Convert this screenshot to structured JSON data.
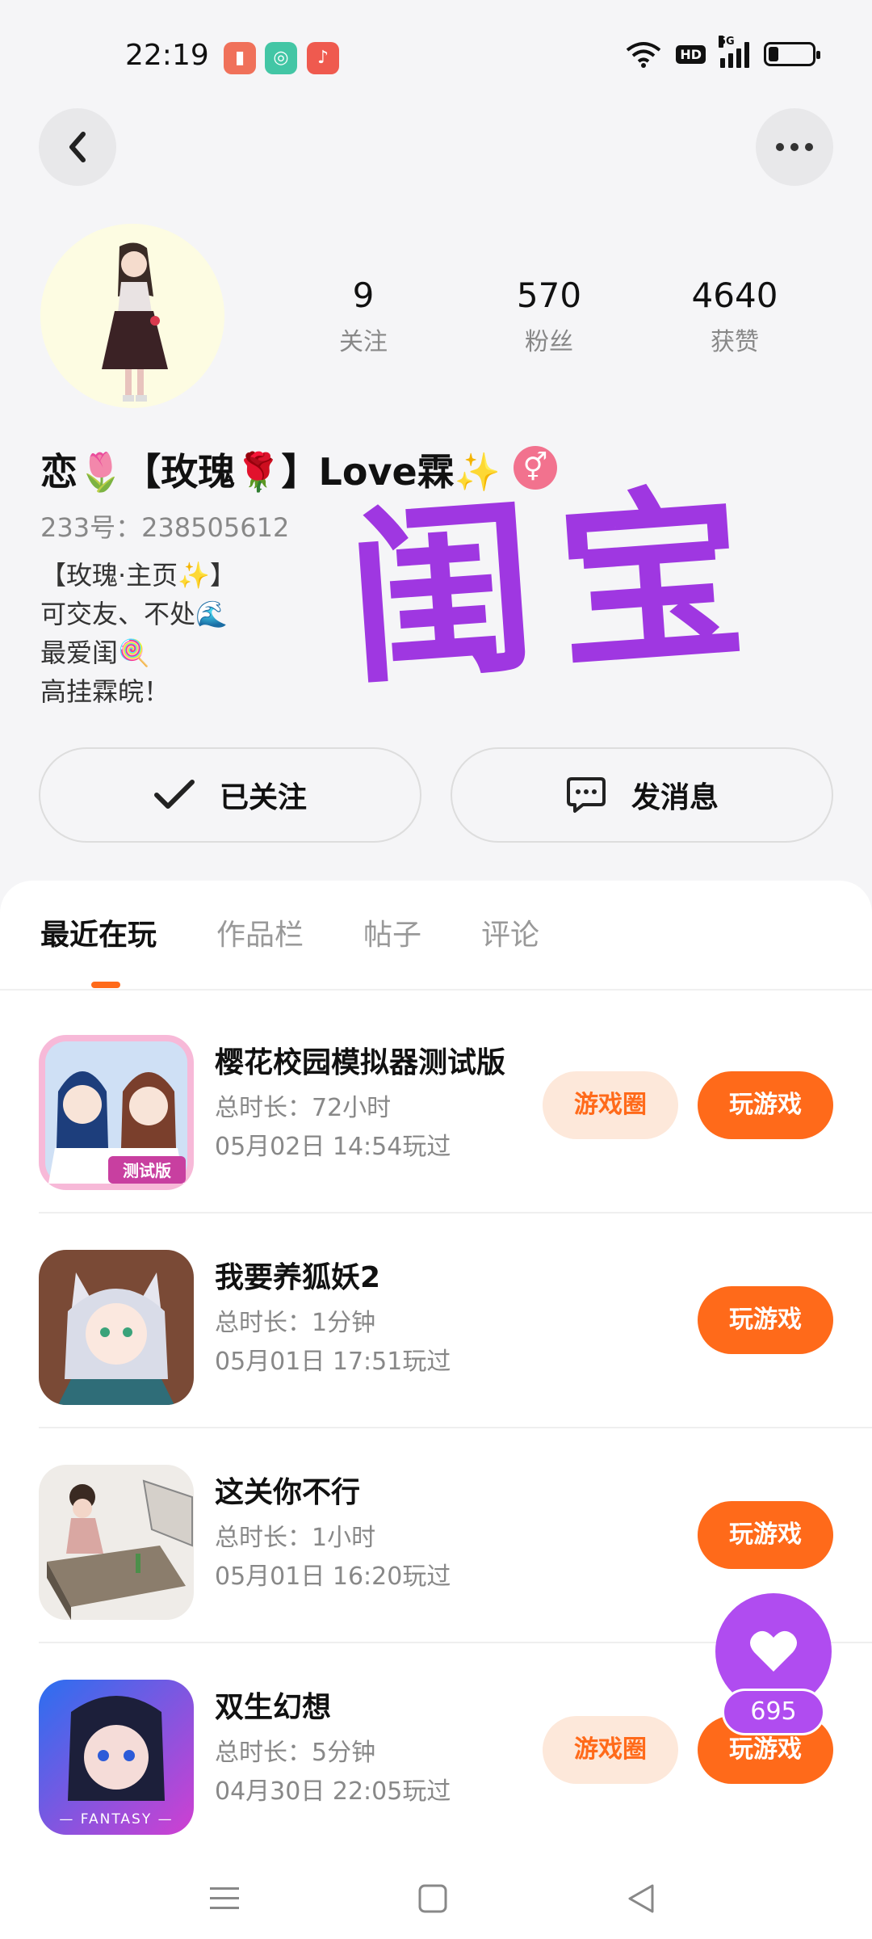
{
  "status_bar": {
    "time": "22:19",
    "network": "5G",
    "hd_label": "HD"
  },
  "profile": {
    "stats": [
      {
        "value": "9",
        "label": "关注"
      },
      {
        "value": "570",
        "label": "粉丝"
      },
      {
        "value": "4640",
        "label": "获赞"
      }
    ],
    "nickname": "恋🌷【玫瑰🌹】Love霖✨",
    "gender_symbol": "⚥",
    "user_id": "233号：238505612",
    "bio": [
      "【玫瑰·主页✨】",
      "可交友、不处🌊",
      "最爱闺🍭",
      "高挂霖皖！"
    ],
    "watermark_text": "闺宝"
  },
  "actions": {
    "follow_label": "已关注",
    "message_label": "发消息"
  },
  "tabs": [
    {
      "label": "最近在玩"
    },
    {
      "label": "作品栏"
    },
    {
      "label": "帖子"
    },
    {
      "label": "评论"
    }
  ],
  "games": [
    {
      "title": "樱花校园模拟器测试版",
      "duration": "总时长：72小时",
      "last_played": "05月02日 14:54玩过",
      "circle_label": "游戏圈",
      "play_label": "玩游戏"
    },
    {
      "title": "我要养狐妖2",
      "duration": "总时长：1分钟",
      "last_played": "05月01日 17:51玩过",
      "play_label": "玩游戏"
    },
    {
      "title": "这关你不行",
      "duration": "总时长：1小时",
      "last_played": "05月01日 16:20玩过",
      "play_label": "玩游戏"
    },
    {
      "title": "双生幻想",
      "duration": "总时长：5分钟",
      "last_played": "04月30日 22:05玩过",
      "circle_label": "游戏圈",
      "play_label": "玩游戏"
    }
  ],
  "game_icon_texts": {
    "test_badge": "测试版",
    "fantasy_label": "— FANTASY —"
  },
  "like_count": "695",
  "colors": {
    "accent": "#ff6a1a",
    "like_purple": "#b04cf0",
    "watermark": "#9b2de0"
  }
}
